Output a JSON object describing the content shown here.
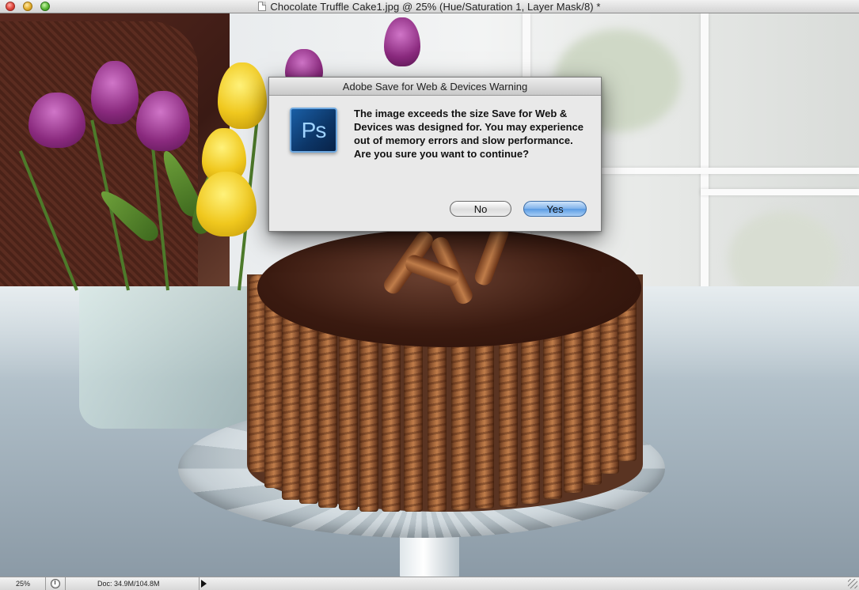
{
  "window": {
    "title": "Chocolate Truffle Cake1.jpg @ 25% (Hue/Saturation 1, Layer Mask/8) *"
  },
  "dialog": {
    "title": "Adobe Save for Web & Devices Warning",
    "icon_text": "Ps",
    "message": "The image exceeds the size Save for Web & Devices was designed for. You may experience out of memory errors and slow performance. Are you sure you want to continue?",
    "no_label": "No",
    "yes_label": "Yes"
  },
  "statusbar": {
    "zoom": "25%",
    "doc_info": "Doc: 34.9M/104.8M"
  },
  "icons": {
    "close": "close-icon",
    "minimize": "minimize-icon",
    "zoom": "zoom-window-icon",
    "document": "document-icon",
    "photoshop": "photoshop-app-icon",
    "status": "status-info-icon",
    "menu_arrow": "play-arrow-icon",
    "resize": "resize-grip-icon"
  },
  "colors": {
    "default_button": "#5a9be3",
    "dialog_bg": "#e9e9e9",
    "ps_icon_bg": "#0c3566"
  }
}
